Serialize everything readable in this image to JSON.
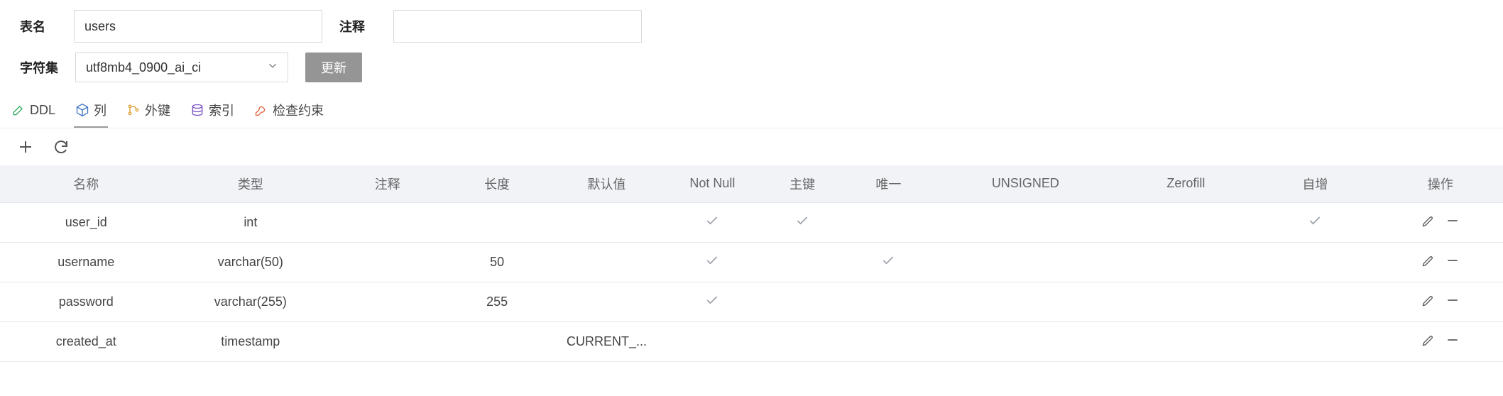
{
  "form": {
    "table_name_label": "表名",
    "table_name_value": "users",
    "comment_label": "注释",
    "comment_value": "",
    "charset_label": "字符集",
    "charset_value": "utf8mb4_0900_ai_ci",
    "update_button": "更新"
  },
  "tabs": {
    "ddl": "DDL",
    "columns": "列",
    "fk": "外键",
    "index": "索引",
    "check": "检查约束"
  },
  "columns_header": {
    "name": "名称",
    "type": "类型",
    "comment": "注释",
    "length": "长度",
    "default": "默认值",
    "not_null": "Not Null",
    "pk": "主键",
    "unique": "唯一",
    "unsigned": "UNSIGNED",
    "zerofill": "Zerofill",
    "autoinc": "自增",
    "ops": "操作"
  },
  "rows": [
    {
      "name": "user_id",
      "type": "int",
      "comment": "",
      "length": "",
      "default": "",
      "not_null": true,
      "pk": true,
      "unique": false,
      "unsigned": false,
      "zerofill": false,
      "autoinc": true
    },
    {
      "name": "username",
      "type": "varchar(50)",
      "comment": "",
      "length": "50",
      "default": "",
      "not_null": true,
      "pk": false,
      "unique": true,
      "unsigned": false,
      "zerofill": false,
      "autoinc": false
    },
    {
      "name": "password",
      "type": "varchar(255)",
      "comment": "",
      "length": "255",
      "default": "",
      "not_null": true,
      "pk": false,
      "unique": false,
      "unsigned": false,
      "zerofill": false,
      "autoinc": false
    },
    {
      "name": "created_at",
      "type": "timestamp",
      "comment": "",
      "length": "",
      "default": "CURRENT_...",
      "not_null": false,
      "pk": false,
      "unique": false,
      "unsigned": false,
      "zerofill": false,
      "autoinc": false
    }
  ]
}
